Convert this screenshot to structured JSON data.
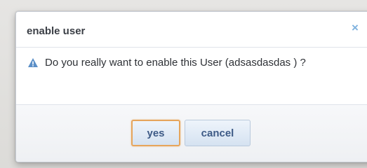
{
  "dialog": {
    "title": "enable user",
    "close_icon": "×",
    "message": "Do you really want to enable this User (adsasdasdas ) ?",
    "alert_icon": "warning-icon",
    "buttons": {
      "yes_label": "yes",
      "cancel_label": "cancel"
    }
  },
  "colors": {
    "accent": "#e6a55c",
    "button_text": "#3d5a86",
    "close_icon": "#7fb2de",
    "warning_icon": "#5b8fc7"
  }
}
